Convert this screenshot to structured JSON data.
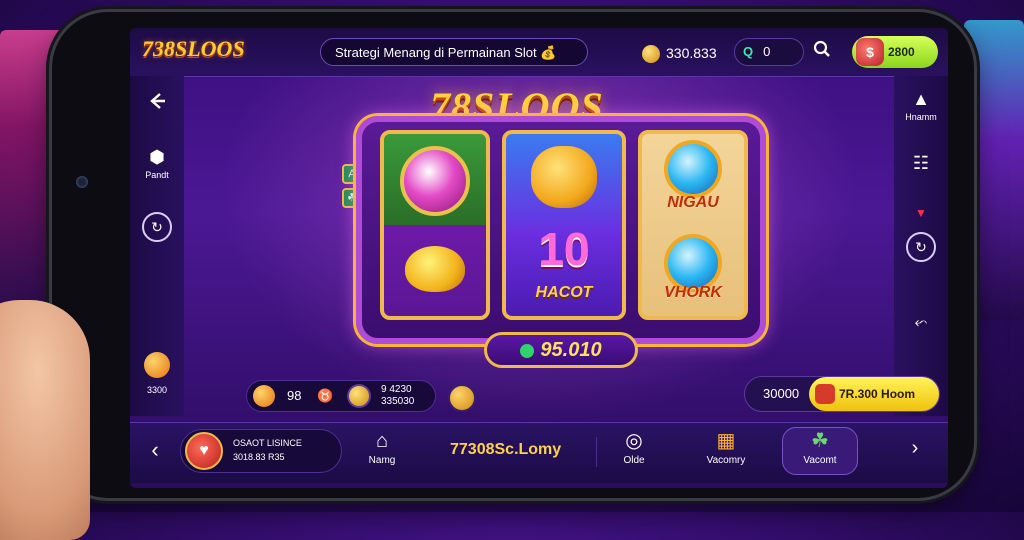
{
  "header": {
    "logo": "738SLOOS",
    "notice": "Strategi Menang di Permainan Slot",
    "notice_emoji": "💰",
    "coins": "330.833",
    "search_value": "0",
    "search_symbol": "Q",
    "balance": "2800"
  },
  "left_sidebar": {
    "back_icon": "←",
    "item1_label": "Pandt",
    "item2_label": "",
    "item3_label": "3300",
    "item1_icon": "⬢",
    "item2_icon": "↻"
  },
  "right_sidebar": {
    "item1_label": "Hnamm",
    "item1_icon": "▲",
    "grid_icon": "☷",
    "arrow_icon": "▼",
    "refresh_icon": "↻",
    "share_icon": "⬿"
  },
  "game": {
    "title": "78SLOOS",
    "reel2_big": "10",
    "reel2_word": "HACOT",
    "reel3_word_top": "NIGAU",
    "reel3_word_bottom": "VHORK",
    "mini_tiles": [
      "A",
      "☘"
    ],
    "win_amount": "95.010"
  },
  "stats": {
    "left_value": "98",
    "left_hand": "♉",
    "left_line1": "9 4230",
    "left_line2": "335030",
    "right_value": "30000",
    "right_button": "7R.300 Hoom"
  },
  "bottom_nav": {
    "back": "‹",
    "profile_line1": "OSAOT LISINCE",
    "profile_line2": "3018.83 R35",
    "home_label": "Namg",
    "home_icon": "⌂",
    "brand": "77308Sc.Lomy",
    "item3_label": "Olde",
    "item3_icon": "◎",
    "item4_label": "Vacomry",
    "item4_icon": "▦",
    "item5_label": "Vacomt",
    "item5_icon": "☘",
    "next": "›"
  }
}
